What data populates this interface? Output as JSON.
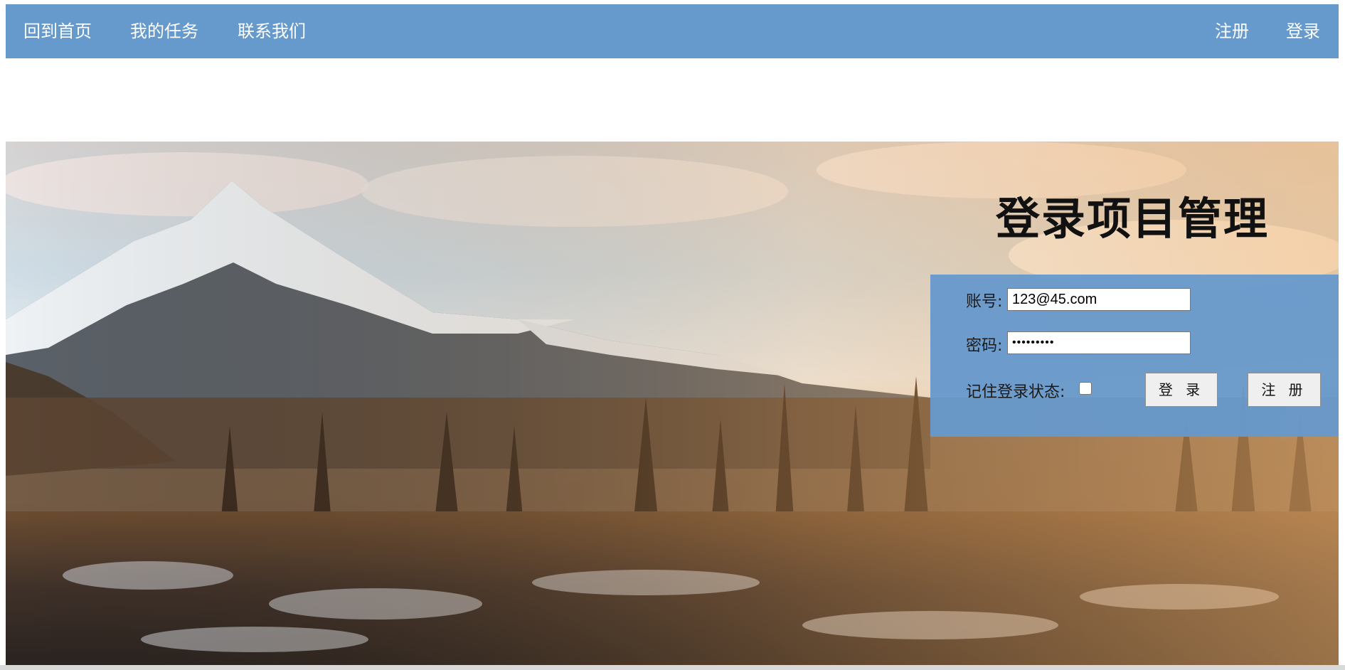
{
  "nav": {
    "left": [
      "回到首页",
      "我的任务",
      "联系我们"
    ],
    "right": [
      "注册",
      "登录"
    ]
  },
  "hero": {
    "title": "登录项目管理"
  },
  "login": {
    "account_label": "账号:",
    "account_value": "123@45.com",
    "password_label": "密码:",
    "password_value": "•••••••••",
    "remember_label": "记住登录状态:",
    "remember_checked": false,
    "login_button": "登 录",
    "register_button": "注 册"
  },
  "colors": {
    "nav_bg": "#6699cc",
    "panel_bg": "#6699cc"
  },
  "icons": {
    "background": "mountain-forest-landscape"
  }
}
